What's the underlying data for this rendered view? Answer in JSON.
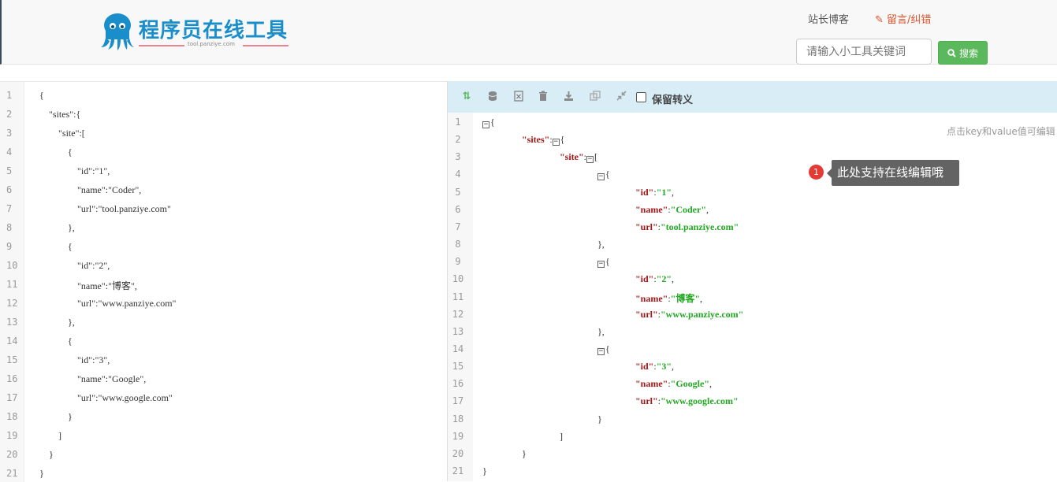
{
  "header": {
    "logo_text": "程序员在线工具",
    "logo_sub": "tool.panziye.com",
    "nav_blog": "站长博客",
    "nav_message": "留言/纠错",
    "search_placeholder": "请输入小工具关键词",
    "search_button": "搜索"
  },
  "toolbar": {
    "icons": [
      "sort-icon",
      "database-icon",
      "excel-icon",
      "trash-icon",
      "download-icon",
      "copy-icon",
      "compress-icon"
    ],
    "checkbox_label": "保留转义"
  },
  "editor": {
    "line_numbers": [
      "1",
      "2",
      "3",
      "4",
      "5",
      "6",
      "7",
      "8",
      "9",
      "10",
      "11",
      "12",
      "13",
      "14",
      "15",
      "16",
      "17",
      "18",
      "19",
      "20",
      "21"
    ],
    "lines": [
      "{",
      "    \"sites\":{",
      "        \"site\":[",
      "            {",
      "                \"id\":\"1\",",
      "                \"name\":\"Coder\",",
      "                \"url\":\"tool.panziye.com\"",
      "            },",
      "            {",
      "                \"id\":\"2\",",
      "                \"name\":\"博客\",",
      "                \"url\":\"www.panziye.com\"",
      "            },",
      "            {",
      "                \"id\":\"3\",",
      "                \"name\":\"Google\",",
      "                \"url\":\"www.google.com\"",
      "            }",
      "        ]",
      "    }",
      "}"
    ]
  },
  "viewer": {
    "hint": "点击key和value值可编辑",
    "tooltip_badge": "1",
    "tooltip_text": "此处支持在线编辑哦",
    "rows": [
      {
        "k": "",
        "v": "",
        "t": "{",
        "fold": true
      },
      {
        "k": "sites",
        "v": "",
        "t": ":{",
        "fold": true
      },
      {
        "k": "site",
        "v": "",
        "t": ":[",
        "fold": true
      },
      {
        "k": "",
        "v": "",
        "t": "{",
        "fold": true
      },
      {
        "k": "id",
        "v": "1",
        "t": ","
      },
      {
        "k": "name",
        "v": "Coder",
        "t": ","
      },
      {
        "k": "url",
        "v": "tool.panziye.com",
        "t": ""
      },
      {
        "k": "",
        "v": "",
        "t": "},"
      },
      {
        "k": "",
        "v": "",
        "t": "{",
        "fold": true
      },
      {
        "k": "id",
        "v": "2",
        "t": ","
      },
      {
        "k": "name",
        "v": "博客",
        "t": ","
      },
      {
        "k": "url",
        "v": "www.panziye.com",
        "t": ""
      },
      {
        "k": "",
        "v": "",
        "t": "},"
      },
      {
        "k": "",
        "v": "",
        "t": "{",
        "fold": true
      },
      {
        "k": "id",
        "v": "3",
        "t": ","
      },
      {
        "k": "name",
        "v": "Google",
        "t": ","
      },
      {
        "k": "url",
        "v": "www.google.com",
        "t": ""
      },
      {
        "k": "",
        "v": "",
        "t": "}"
      },
      {
        "k": "",
        "v": "",
        "t": "]"
      },
      {
        "k": "",
        "v": "",
        "t": "}"
      },
      {
        "k": "",
        "v": "",
        "t": "}"
      }
    ]
  },
  "colors": {
    "brand": "#1a8ecb",
    "search_button": "#5cb85c",
    "toolbar_bg": "#d9edf7",
    "key": "#a31515",
    "value": "#22a822",
    "badge": "#e53935"
  }
}
